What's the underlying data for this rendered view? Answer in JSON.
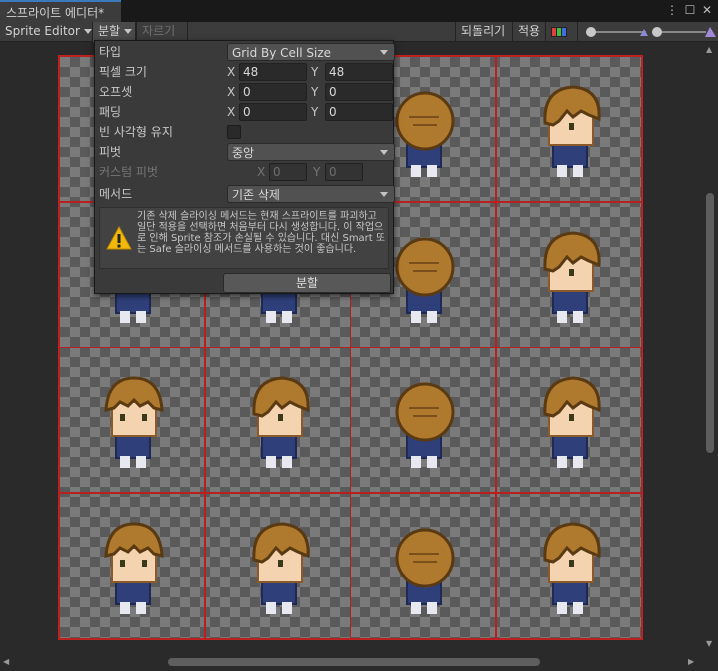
{
  "window": {
    "tab_title": "스프라이트 에디터*",
    "more_icon": "kebab-menu",
    "maximize_icon": "maximize",
    "close_icon": "close"
  },
  "toolbar": {
    "mode_label": "Sprite Editor",
    "slice_label": "분할",
    "trim_label": "자르기",
    "revert_label": "되돌리기",
    "apply_label": "적용",
    "color_toggle_icon": "rgb-channel-icon"
  },
  "slice_popup": {
    "type_label": "타입",
    "type_value": "Grid By Cell Size",
    "pixel_size_label": "픽셀 크기",
    "pixel_size": {
      "x": "48",
      "y": "48"
    },
    "offset_label": "오프셋",
    "offset": {
      "x": "0",
      "y": "0"
    },
    "padding_label": "패딩",
    "padding": {
      "x": "0",
      "y": "0"
    },
    "keep_empty_label": "빈 사각형 유지",
    "pivot_label": "피벗",
    "pivot_value": "중앙",
    "custom_pivot_label": "커스텀 피벗",
    "custom_pivot": {
      "x": "0",
      "y": "0"
    },
    "method_label": "메서드",
    "method_value": "기존 삭제",
    "warning_text": "기존 삭제 슬라이싱 메서드는 현재 스프라이트를 파괴하고 일단 적용을 선택하면 처음부터 다시 생성합니다. 이 작업으로 인해 Sprite 참조가 손실될 수 있습니다. 대신 Smart 또는 Safe 슬라이싱 메서드를 사용하는 것이 좋습니다.",
    "slice_button": "분할",
    "axis_x": "X",
    "axis_y": "Y"
  },
  "colors": {
    "grid_line": "#c42020",
    "accent": "#3a79bb",
    "hair": "#b07a2e",
    "shirt": "#2f3f7a",
    "skin": "#f4d4b0"
  }
}
